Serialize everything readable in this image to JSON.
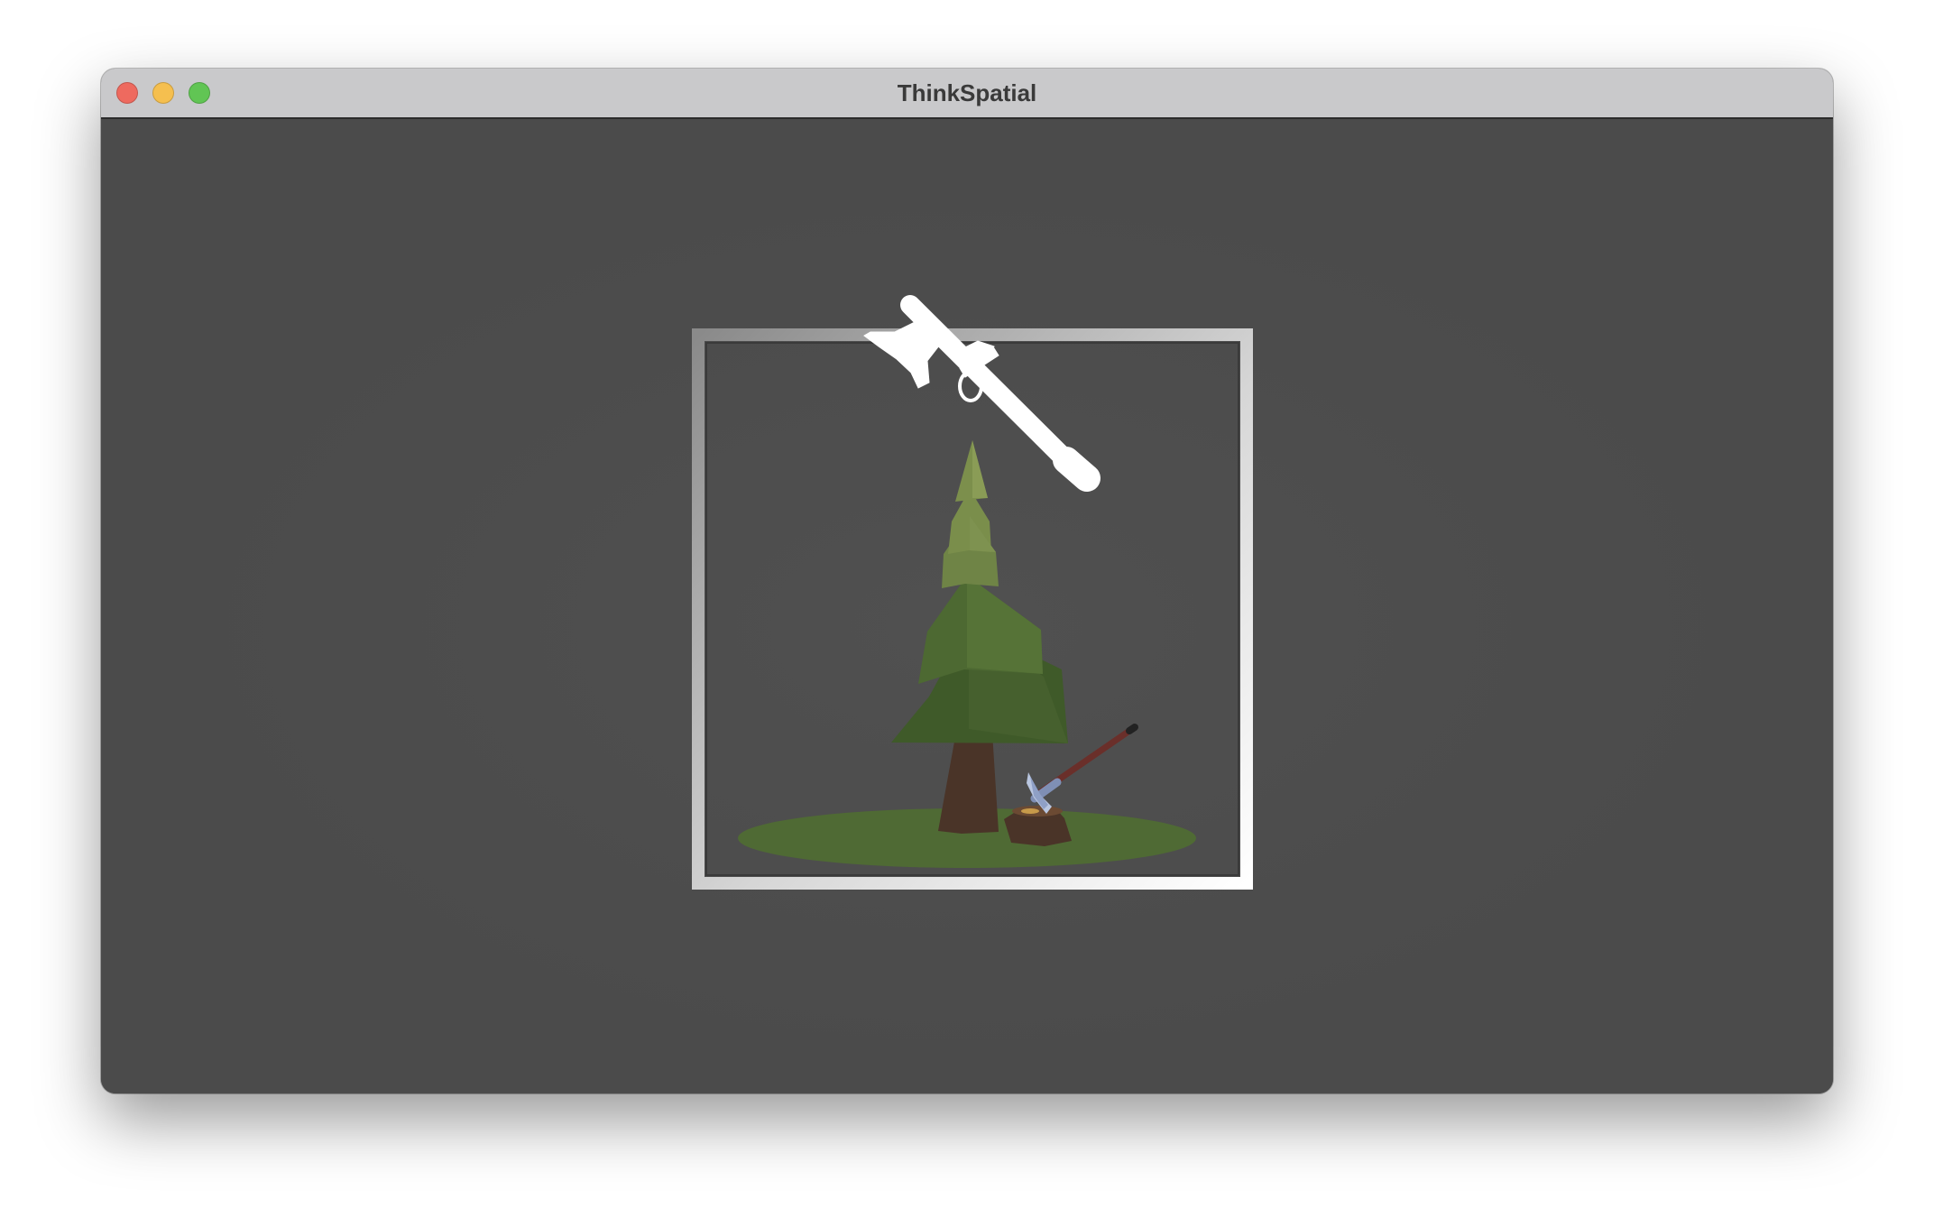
{
  "window": {
    "title": "ThinkSpatial"
  },
  "traffic_lights": {
    "close_color": "#ee6a5f",
    "minimize_color": "#f5bf4f",
    "zoom_color": "#61c554"
  },
  "scene": {
    "background_color": "#4b4b4b",
    "frame_colors": [
      "#ffffff",
      "#8f8f8f"
    ],
    "grass_color": "#4f6a34",
    "tree_foliage_light": "#7c8f4c",
    "tree_foliage_dark": "#46602e",
    "trunk_color": "#4a3428",
    "axe_head_color": "#7f8fb5",
    "axe_handle_color": "#6a2f2a",
    "silhouette_color": "#ffffff",
    "icons": [
      "axe-silhouette-icon",
      "pine-tree-icon",
      "tree-stump-icon",
      "axe-icon"
    ]
  }
}
